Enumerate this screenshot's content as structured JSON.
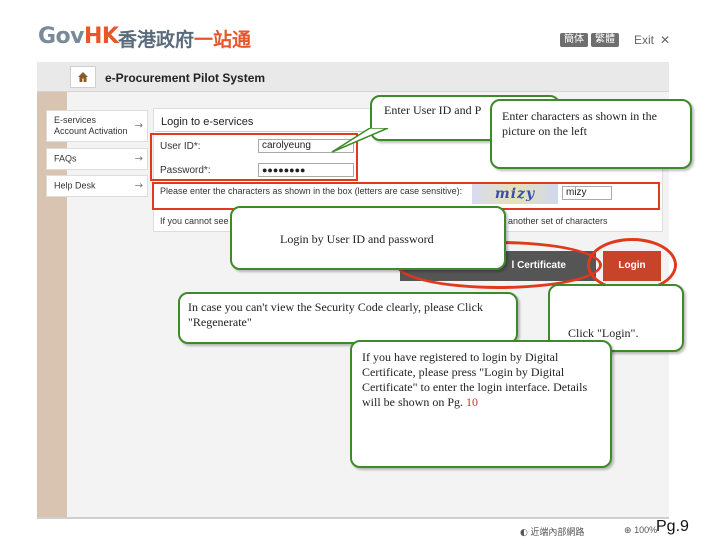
{
  "header": {
    "logo_gov": "Gov",
    "logo_hk": "HK",
    "logo_cn_main": "香港政府",
    "logo_cn_red": "一站通",
    "lang_simplified": "簡体",
    "lang_traditional": "繁體",
    "exit_label": "Exit",
    "exit_icon": "close-icon"
  },
  "system": {
    "title": "e-Procurement Pilot System",
    "icon": "house-icon"
  },
  "sidebar": {
    "items": [
      {
        "line1": "E-services",
        "line2": "Account Activation"
      },
      {
        "line1": "FAQs",
        "line2": ""
      },
      {
        "line1": "Help Desk",
        "line2": ""
      }
    ],
    "arrow": "→"
  },
  "login": {
    "title": "Login to e-services",
    "user_id_label": "User ID*:",
    "user_id_value": "carolyeung",
    "password_label": "Password*:",
    "password_value": "●●●●●●●●",
    "captcha_instruction": "Please enter the characters as shown in the box (letters are case sensitive):",
    "captcha_image_text": "mizy",
    "captcha_input_value": "mizy",
    "cannot_see_prefix": "If you cannot see",
    "another_set_suffix": "another set of characters",
    "digital_cert_button": "l Certificate",
    "login_button": "Login"
  },
  "callouts": {
    "enter_user_id": "Enter User ID and P",
    "enter_characters": "Enter characters as shown in the picture on the left",
    "login_by_id": "Login by User ID and password",
    "regenerate": "In case you can't view the Security Code clearly, please Click \"Regenerate\"",
    "click_login": "Click \"Login\".",
    "digital_cert_info": "If you have registered to login by Digital Certificate, please press \"Login by Digital Certificate\" to enter the login interface. Details will be shown on Pg.",
    "digital_cert_page": "10"
  },
  "status_bar": {
    "item1": "近端內部網路",
    "item2": "100%"
  },
  "page_number": "Pg.9"
}
